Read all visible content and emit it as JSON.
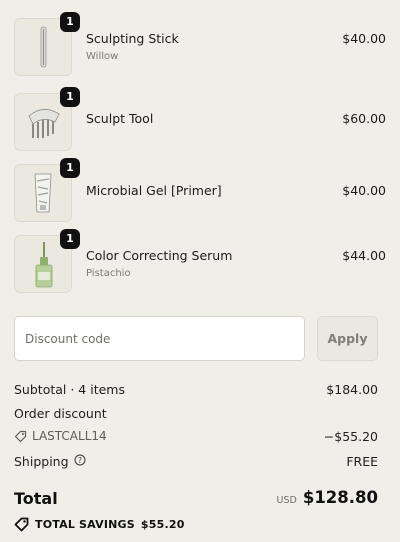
{
  "items": [
    {
      "name": "Sculpting Stick",
      "variant": "Willow",
      "price": "$40.00",
      "quantity": "1",
      "icon": "sculpting-stick-image"
    },
    {
      "name": "Sculpt Tool",
      "variant": "",
      "price": "$60.00",
      "quantity": "1",
      "icon": "sculpt-tool-image"
    },
    {
      "name": "Microbial Gel [Primer]",
      "variant": "",
      "price": "$40.00",
      "quantity": "1",
      "icon": "gel-sachet-image"
    },
    {
      "name": "Color Correcting Serum",
      "variant": "Pistachio",
      "price": "$44.00",
      "quantity": "1",
      "icon": "serum-bottle-image"
    }
  ],
  "discount": {
    "placeholder": "Discount code",
    "apply_label": "Apply"
  },
  "summary": {
    "subtotal_label": "Subtotal · 4 items",
    "subtotal_value": "$184.00",
    "order_discount_label": "Order discount",
    "discount_code": "LASTCALL14",
    "discount_value": "−$55.20",
    "shipping_label": "Shipping",
    "shipping_value": "FREE",
    "total_label": "Total",
    "currency": "USD",
    "total_value": "$128.80",
    "savings_label": "TOTAL SAVINGS",
    "savings_value": "$55.20"
  },
  "colors": {
    "background": "#efeee8",
    "badge": "#111111",
    "apply_text": "#7e7e78"
  }
}
